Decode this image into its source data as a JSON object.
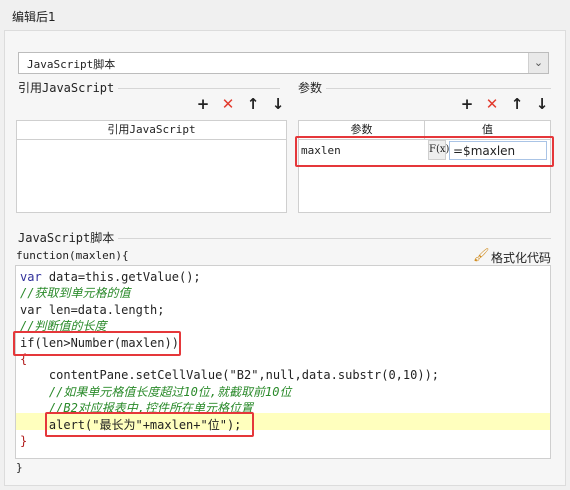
{
  "window": {
    "title": "编辑后1"
  },
  "script_type": {
    "selected": "JavaScript脚本"
  },
  "left_group": {
    "label": "引用JavaScript",
    "column_header": "引用JavaScript"
  },
  "right_group": {
    "label": "参数",
    "columns": [
      "参数",
      "值"
    ],
    "rows": [
      {
        "param": "maxlen",
        "fx": "F(x)",
        "value": "=$maxlen"
      }
    ]
  },
  "toolbar_icons": [
    "plus-icon",
    "delete-icon",
    "arrow-up-icon",
    "arrow-down-icon"
  ],
  "script_section": {
    "label": "JavaScript脚本",
    "signature": "function(maxlen){",
    "format_button": "格式化代码",
    "closing": "}"
  },
  "code_lines": [
    "var data=this.getValue();",
    "//获取到单元格的值",
    "var len=data.length;",
    "//判断值的长度",
    "if(len>Number(maxlen))",
    "{",
    "    contentPane.setCellValue(\"B2\",null,data.substr(0,10));",
    "    //如果单元格值长度超过10位,就截取前10位",
    "    //B2对应报表中,控件所在单元格位置",
    "    alert(\"最长为\"+maxlen+\"位\");",
    "}"
  ],
  "colors": {
    "highlight_box": "#e5373a",
    "delete_icon": "#e23b2e",
    "line_highlight": "#ffffbe"
  }
}
